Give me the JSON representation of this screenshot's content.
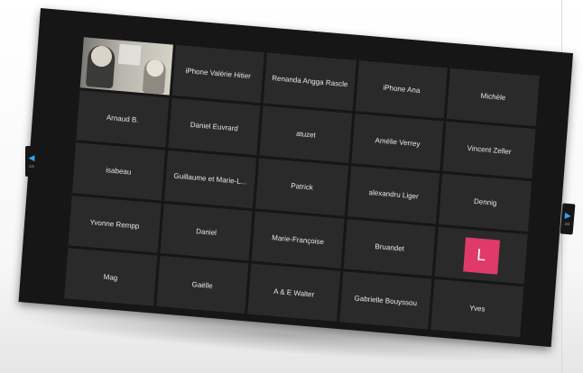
{
  "pager": {
    "left_label": "2/3",
    "right_label": "2/3",
    "left_icon": "arrow-left-icon",
    "right_icon": "arrow-right-icon",
    "arrow_color": "#2fa3ff"
  },
  "participants": [
    {
      "name": "",
      "type": "video"
    },
    {
      "name": "iPhone Valérie Hitier"
    },
    {
      "name": "Renanda Angga Rascle"
    },
    {
      "name": "iPhone Ana"
    },
    {
      "name": "Michèle"
    },
    {
      "name": "Arnaud B."
    },
    {
      "name": "Daniel Euvrard"
    },
    {
      "name": "atuzet"
    },
    {
      "name": "Amélie Verrey"
    },
    {
      "name": "Vincent Zeller"
    },
    {
      "name": "isabeau"
    },
    {
      "name": "Guillaume et Marie-L..."
    },
    {
      "name": "Patrick"
    },
    {
      "name": "alexandru Liger"
    },
    {
      "name": "Dennig"
    },
    {
      "name": "Yvonne Rempp"
    },
    {
      "name": "Daniel"
    },
    {
      "name": "Marie-Françoise"
    },
    {
      "name": "Bruandet"
    },
    {
      "name": "",
      "type": "avatar",
      "initial": "L",
      "color": "#e03a69"
    },
    {
      "name": "Mag"
    },
    {
      "name": "Gaëlle"
    },
    {
      "name": "A & E Walter"
    },
    {
      "name": "Gabrielle Bouyssou"
    },
    {
      "name": "Yves"
    }
  ]
}
